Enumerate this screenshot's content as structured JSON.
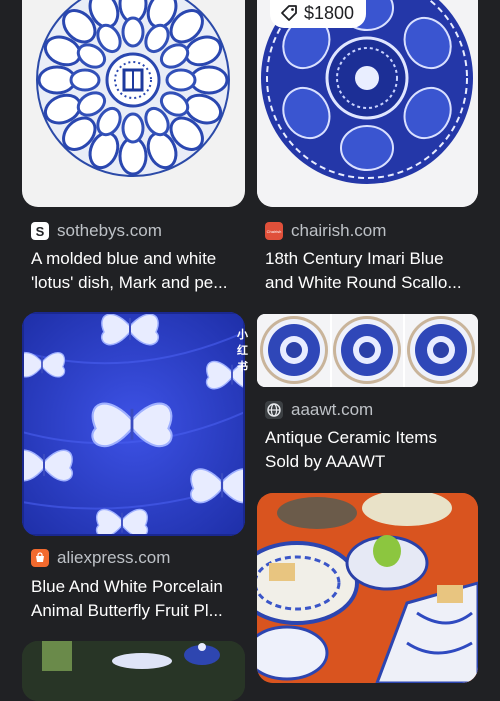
{
  "results": [
    {
      "source": "sothebys.com",
      "title_lines": [
        "A molded blue and white",
        "'lotus' dish, Mark and pe..."
      ],
      "favicon": "S"
    },
    {
      "source": "chairish.com",
      "title_lines": [
        "18th Century Imari Blue",
        "and White Round Scallo..."
      ],
      "price": "$1800",
      "favicon_text": "Chairish"
    },
    {
      "source": "aaawt.com",
      "title_lines": [
        "Antique Ceramic Items",
        "Sold by AAAWT"
      ],
      "watermark": "小红书"
    },
    {
      "source": "aliexpress.com",
      "title_lines": [
        "Blue And White Porcelain",
        "Animal Butterfly Fruit Pl..."
      ]
    }
  ],
  "colors": {
    "background": "#202124",
    "cobalt": "#2a3fc0",
    "chairish_red": "#e0503a",
    "aliexpress_orange": "#f26a2e"
  },
  "icons": [
    "price-tag-icon",
    "sothebys-favicon",
    "chairish-favicon",
    "aaawt-globe-icon",
    "aliexpress-favicon"
  ]
}
